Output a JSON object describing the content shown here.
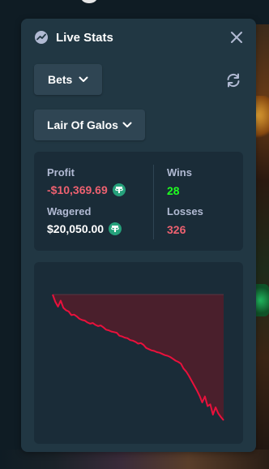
{
  "panel": {
    "title": "Live Stats",
    "icon": "chart-line-icon",
    "close_icon": "close-icon",
    "refresh_icon": "refresh-icon"
  },
  "filters": {
    "bets_label": "Bets",
    "game_label": "Lair Of Galos"
  },
  "stats": {
    "profit_label": "Profit",
    "profit_value": "-$10,369.69",
    "wagered_label": "Wagered",
    "wagered_value": "$20,050.00",
    "wins_label": "Wins",
    "wins_value": "28",
    "losses_label": "Losses",
    "losses_value": "326",
    "currency_icon": "tether-coin-icon"
  },
  "colors": {
    "negative": "#ed6170",
    "positive": "#1fff20",
    "panel": "#213743",
    "inner": "#1a2c38",
    "button": "#2f4553",
    "line": "#e9113c",
    "fill": "#4a1f2c"
  },
  "chart_data": {
    "type": "area",
    "x": [
      0,
      1,
      2,
      3,
      4,
      5,
      6,
      7,
      8,
      9,
      10,
      11,
      12,
      13,
      14,
      15,
      16,
      17,
      18,
      19,
      20,
      21,
      22,
      23,
      24,
      25,
      26,
      27,
      28,
      29,
      30,
      31,
      32,
      33,
      34,
      35,
      36,
      37,
      38,
      39,
      40,
      41,
      42,
      43,
      44,
      45,
      46,
      47,
      48,
      49,
      50,
      51,
      52,
      53,
      54,
      55,
      56,
      57,
      58,
      59,
      60,
      61,
      62,
      63,
      64
    ],
    "values": [
      0,
      -600,
      -1000,
      -500,
      -1100,
      -1300,
      -1400,
      -1700,
      -1650,
      -1800,
      -2000,
      -2100,
      -2150,
      -2300,
      -2400,
      -2350,
      -2500,
      -2600,
      -2550,
      -2700,
      -2900,
      -2950,
      -3050,
      -3100,
      -3150,
      -3400,
      -3450,
      -3550,
      -3600,
      -3750,
      -3800,
      -3900,
      -4050,
      -4000,
      -4150,
      -4400,
      -4500,
      -4600,
      -4650,
      -4750,
      -4800,
      -4900,
      -5000,
      -5050,
      -5150,
      -5300,
      -5450,
      -5550,
      -5700,
      -6100,
      -6350,
      -6700,
      -7100,
      -7500,
      -7900,
      -8350,
      -8900,
      -8400,
      -9200,
      -9050,
      -9900,
      -9300,
      -9800,
      -10100,
      -10369.69
    ],
    "ylim": [
      -10369.69,
      0
    ],
    "grid": false
  }
}
